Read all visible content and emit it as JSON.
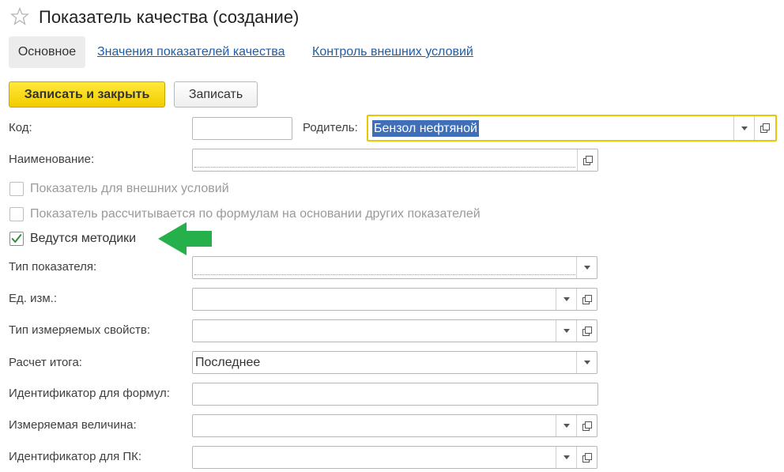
{
  "header": {
    "title": "Показатель качества (создание)",
    "star_icon": "star-icon"
  },
  "tabs": [
    {
      "label": "Основное",
      "active": true
    },
    {
      "label": "Значения показателей качества",
      "active": false
    },
    {
      "label": "Контроль внешних условий",
      "active": false
    }
  ],
  "toolbar": {
    "save_close_label": "Записать и закрыть",
    "save_label": "Записать"
  },
  "form": {
    "code": {
      "label": "Код:",
      "value": ""
    },
    "parent": {
      "label": "Родитель:",
      "value": "Бензол нефтяной"
    },
    "name": {
      "label": "Наименование:",
      "value": ""
    },
    "checkboxes": [
      {
        "label": "Показатель для внешних условий",
        "checked": false,
        "enabled": false
      },
      {
        "label": "Показатель рассчитывается по формулам на основании других показателей",
        "checked": false,
        "enabled": false
      },
      {
        "label": "Ведутся методики",
        "checked": true,
        "enabled": true
      }
    ],
    "indicator_type": {
      "label": "Тип показателя:",
      "value": ""
    },
    "unit": {
      "label": "Ед. изм.:",
      "value": ""
    },
    "measured_props_type": {
      "label": "Тип измеряемых свойств:",
      "value": ""
    },
    "total_calc": {
      "label": "Расчет итога:",
      "value": "Последнее"
    },
    "formula_id": {
      "label": "Идентификатор для формул:",
      "value": ""
    },
    "measured_quantity": {
      "label": "Измеряемая величина:",
      "value": ""
    },
    "pc_id": {
      "label": "Идентификатор для ПК:",
      "value": ""
    }
  },
  "colors": {
    "primary_button": "#f5d300",
    "link": "#1f5da8",
    "focus_border": "#e8c800",
    "selection": "#3f6fb8",
    "annotation_arrow": "#25b04b"
  }
}
